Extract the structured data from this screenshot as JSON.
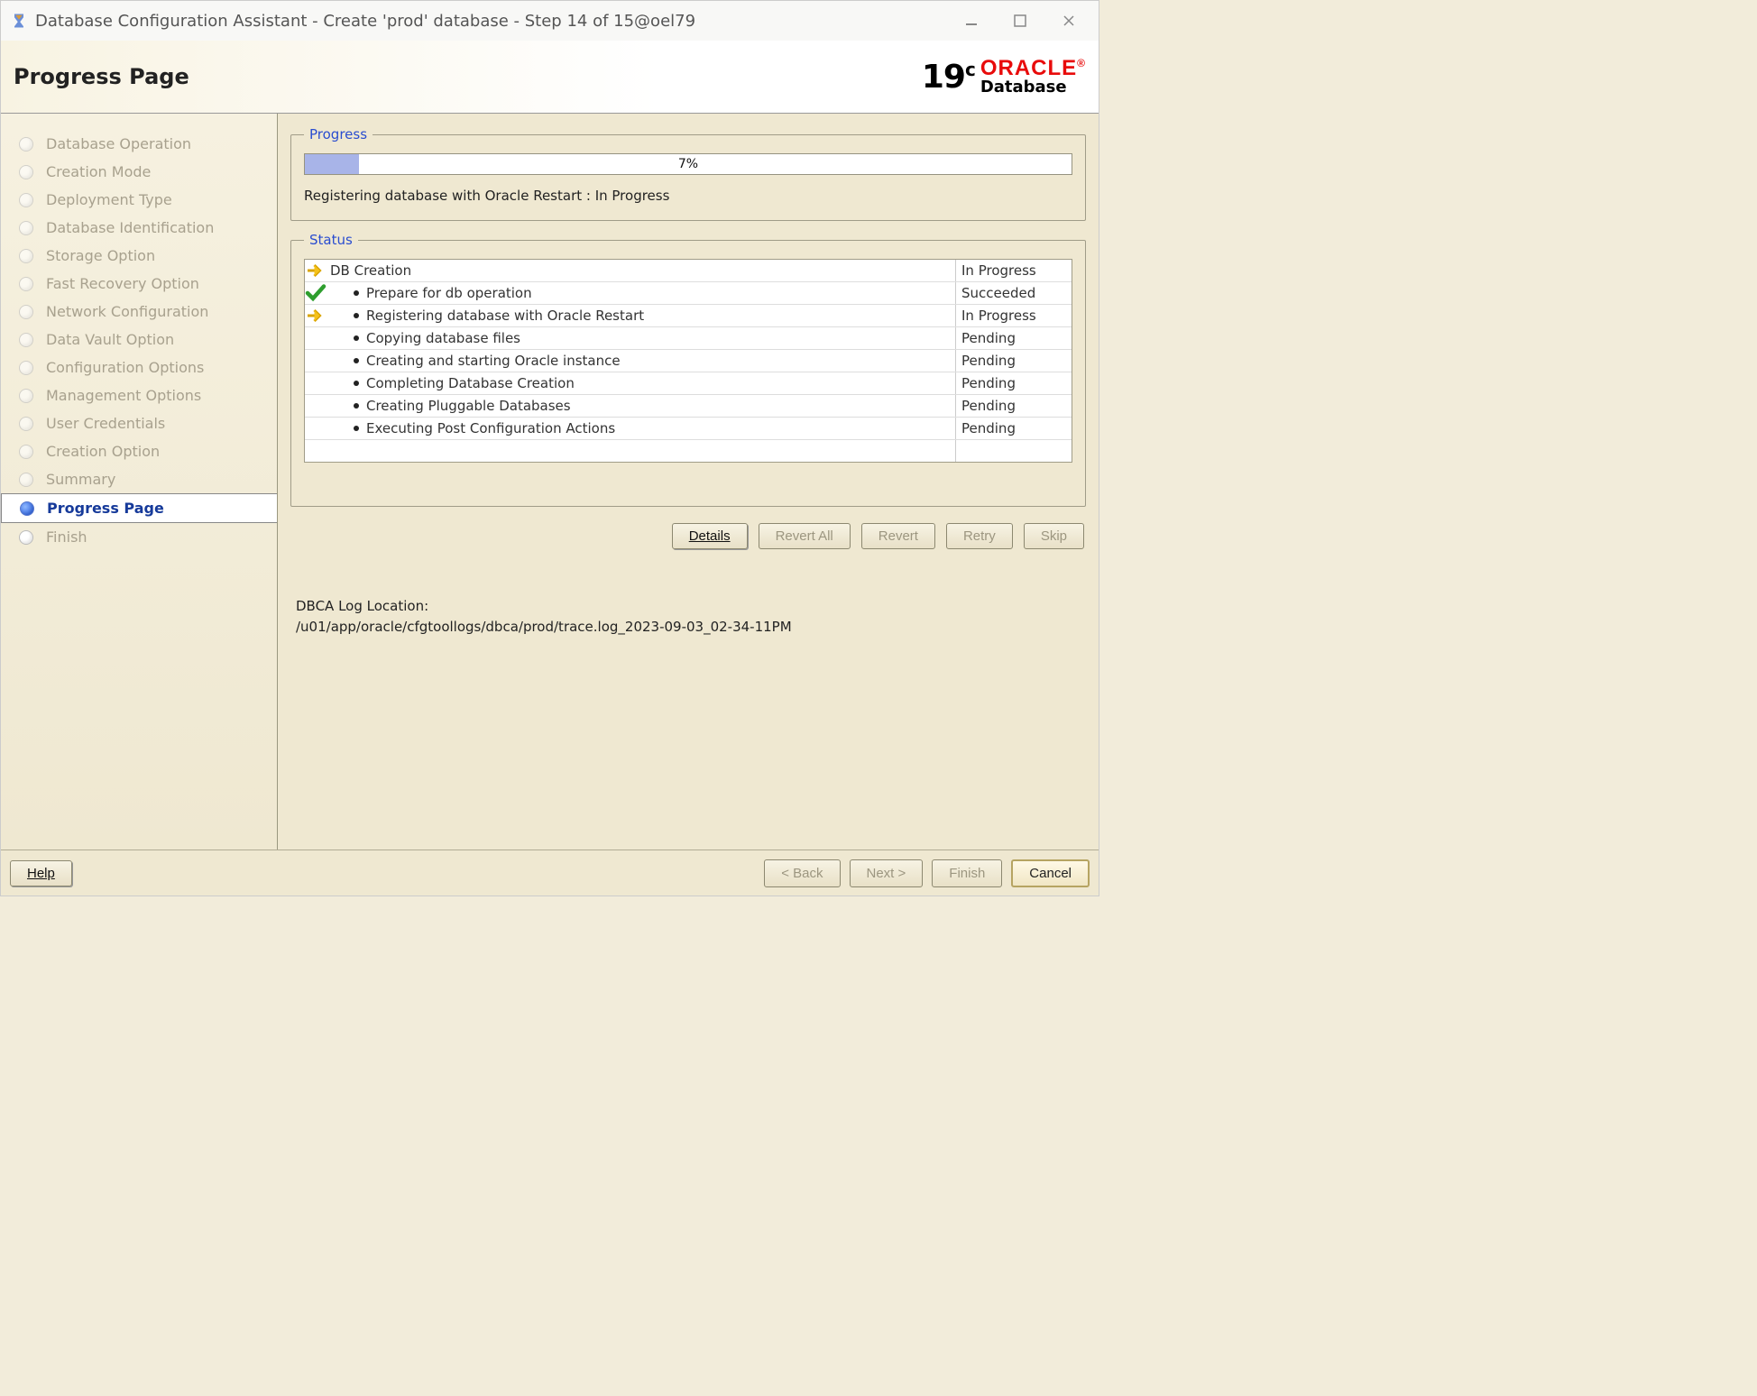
{
  "window": {
    "title": "Database Configuration Assistant - Create 'prod' database - Step 14 of 15@oel79"
  },
  "header": {
    "page_title": "Progress Page",
    "brand_version": "19",
    "brand_version_suffix": "c",
    "brand_name": "ORACLE",
    "brand_sub": "Database"
  },
  "sidebar": {
    "steps": [
      {
        "label": "Database Operation",
        "state": "past"
      },
      {
        "label": "Creation Mode",
        "state": "past"
      },
      {
        "label": "Deployment Type",
        "state": "past"
      },
      {
        "label": "Database Identification",
        "state": "past"
      },
      {
        "label": "Storage Option",
        "state": "past"
      },
      {
        "label": "Fast Recovery Option",
        "state": "past"
      },
      {
        "label": "Network Configuration",
        "state": "past"
      },
      {
        "label": "Data Vault Option",
        "state": "past"
      },
      {
        "label": "Configuration Options",
        "state": "past"
      },
      {
        "label": "Management Options",
        "state": "past"
      },
      {
        "label": "User Credentials",
        "state": "past"
      },
      {
        "label": "Creation Option",
        "state": "past"
      },
      {
        "label": "Summary",
        "state": "past"
      },
      {
        "label": "Progress Page",
        "state": "active"
      },
      {
        "label": "Finish",
        "state": "future"
      }
    ]
  },
  "progress": {
    "legend": "Progress",
    "percent_label": "7%",
    "percent_value": 7,
    "message": "Registering database with Oracle Restart : In Progress"
  },
  "status": {
    "legend": "Status",
    "rows": [
      {
        "icon": "arrow",
        "indent": 0,
        "label": "DB Creation",
        "status": "In Progress"
      },
      {
        "icon": "check",
        "indent": 1,
        "label": "Prepare for db operation",
        "status": "Succeeded"
      },
      {
        "icon": "arrow",
        "indent": 1,
        "label": "Registering database with Oracle Restart",
        "status": "In Progress"
      },
      {
        "icon": "",
        "indent": 1,
        "label": "Copying database files",
        "status": "Pending"
      },
      {
        "icon": "",
        "indent": 1,
        "label": "Creating and starting Oracle instance",
        "status": "Pending"
      },
      {
        "icon": "",
        "indent": 1,
        "label": "Completing Database Creation",
        "status": "Pending"
      },
      {
        "icon": "",
        "indent": 1,
        "label": "Creating Pluggable Databases",
        "status": "Pending"
      },
      {
        "icon": "",
        "indent": 1,
        "label": "Executing Post Configuration Actions",
        "status": "Pending"
      }
    ]
  },
  "status_buttons": {
    "details": "Details",
    "revert_all": "Revert All",
    "revert": "Revert",
    "retry": "Retry",
    "skip": "Skip"
  },
  "log": {
    "label": "DBCA Log Location:",
    "path": "/u01/app/oracle/cfgtoollogs/dbca/prod/trace.log_2023-09-03_02-34-11PM"
  },
  "footer": {
    "help": "Help",
    "back": "< Back",
    "next": "Next >",
    "finish": "Finish",
    "cancel": "Cancel"
  }
}
